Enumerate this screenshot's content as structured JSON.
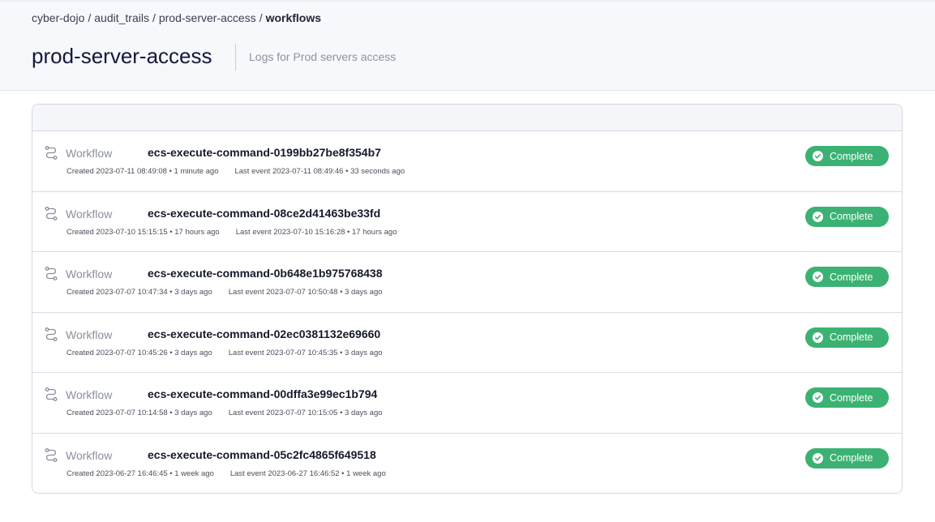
{
  "breadcrumb": {
    "items": [
      "cyber-dojo",
      "audit_trails",
      "prod-server-access"
    ],
    "current": "workflows",
    "separator": "/"
  },
  "page": {
    "title": "prod-server-access",
    "description": "Logs for Prod servers access"
  },
  "workflows": [
    {
      "type_label": "Workflow",
      "name": "ecs-execute-command-0199bb27be8f354b7",
      "created": "Created 2023-07-11 08:49:08 • 1 minute ago",
      "last_event": "Last event 2023-07-11 08:49:46 • 33 seconds ago",
      "status": "Complete"
    },
    {
      "type_label": "Workflow",
      "name": "ecs-execute-command-08ce2d41463be33fd",
      "created": "Created 2023-07-10 15:15:15 • 17 hours ago",
      "last_event": "Last event 2023-07-10 15:16:28 • 17 hours ago",
      "status": "Complete"
    },
    {
      "type_label": "Workflow",
      "name": "ecs-execute-command-0b648e1b975768438",
      "created": "Created 2023-07-07 10:47:34 • 3 days ago",
      "last_event": "Last event 2023-07-07 10:50:48 • 3 days ago",
      "status": "Complete"
    },
    {
      "type_label": "Workflow",
      "name": "ecs-execute-command-02ec0381132e69660",
      "created": "Created 2023-07-07 10:45:26 • 3 days ago",
      "last_event": "Last event 2023-07-07 10:45:35 • 3 days ago",
      "status": "Complete"
    },
    {
      "type_label": "Workflow",
      "name": "ecs-execute-command-00dffa3e99ec1b794",
      "created": "Created 2023-07-07 10:14:58 • 3 days ago",
      "last_event": "Last event 2023-07-07 10:15:05 • 3 days ago",
      "status": "Complete"
    },
    {
      "type_label": "Workflow",
      "name": "ecs-execute-command-05c2fc4865f649518",
      "created": "Created 2023-06-27 16:46:45 • 1 week ago",
      "last_event": "Last event 2023-06-27 16:46:52 • 1 week ago",
      "status": "Complete"
    }
  ],
  "icons": {
    "row": "workflow-icon",
    "status": "check-circle-icon"
  },
  "colors": {
    "status_complete": "#3bb273",
    "title": "#13193a",
    "header_bg": "#f6f8fb"
  }
}
